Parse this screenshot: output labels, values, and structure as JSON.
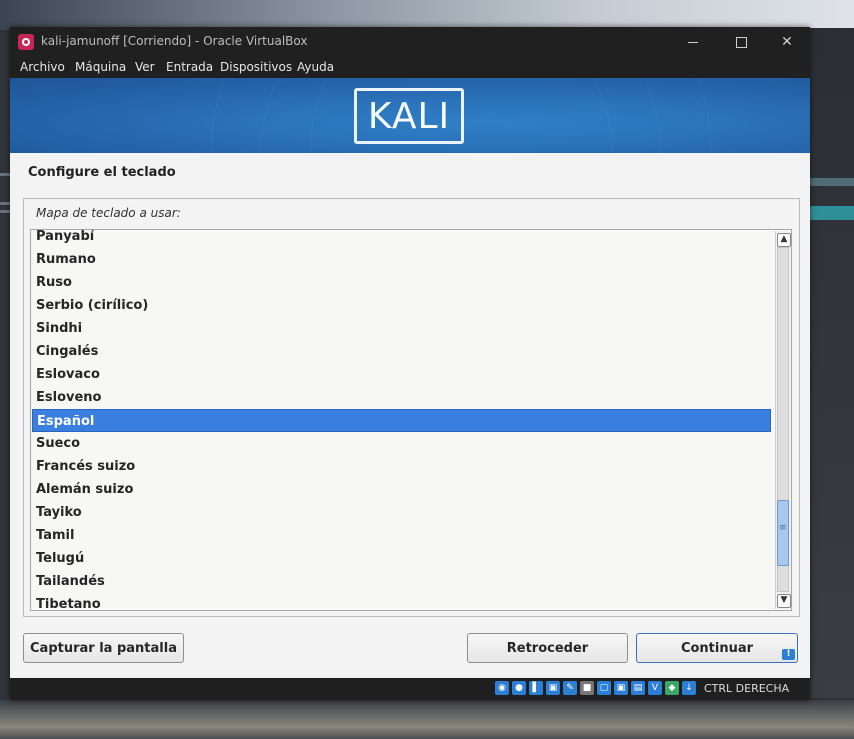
{
  "window": {
    "title": "kali-jamunoff [Corriendo] - Oracle VirtualBox",
    "menu": [
      "Archivo",
      "Máquina",
      "Ver",
      "Entrada",
      "Dispositivos",
      "Ayuda"
    ]
  },
  "banner": {
    "logo_text": "KALI"
  },
  "installer": {
    "title": "Configure el teclado",
    "field_label": "Mapa de teclado a usar:",
    "items": [
      "Panyabí",
      "Rumano",
      "Ruso",
      "Serbio (cirílico)",
      "Sindhi",
      "Cingalés",
      "Eslovaco",
      "Esloveno",
      "Español",
      "Sueco",
      "Francés suizo",
      "Alemán suizo",
      "Tayiko",
      "Tamil",
      "Telugú",
      "Tailandés",
      "Tibetano"
    ],
    "selected_item": "Español",
    "scroll_position": 0.82,
    "buttons": {
      "capture": "Capturar la pantalla",
      "back": "Retroceder",
      "continue": "Continuar"
    }
  },
  "statusbar": {
    "host_key": "CTRL DERECHA",
    "icons": [
      "hard-disk-icon",
      "optical-disk-icon",
      "audio-icon",
      "network-icon",
      "usb-icon",
      "shared-folder-icon",
      "display-icon",
      "recording-icon",
      "cpu-icon",
      "vt-x-icon",
      "mouse-integration-icon",
      "keyboard-capture-icon"
    ]
  },
  "colors": {
    "selection": "#3a7fe0",
    "banner": "#2461a6",
    "window_chrome": "#202020"
  }
}
